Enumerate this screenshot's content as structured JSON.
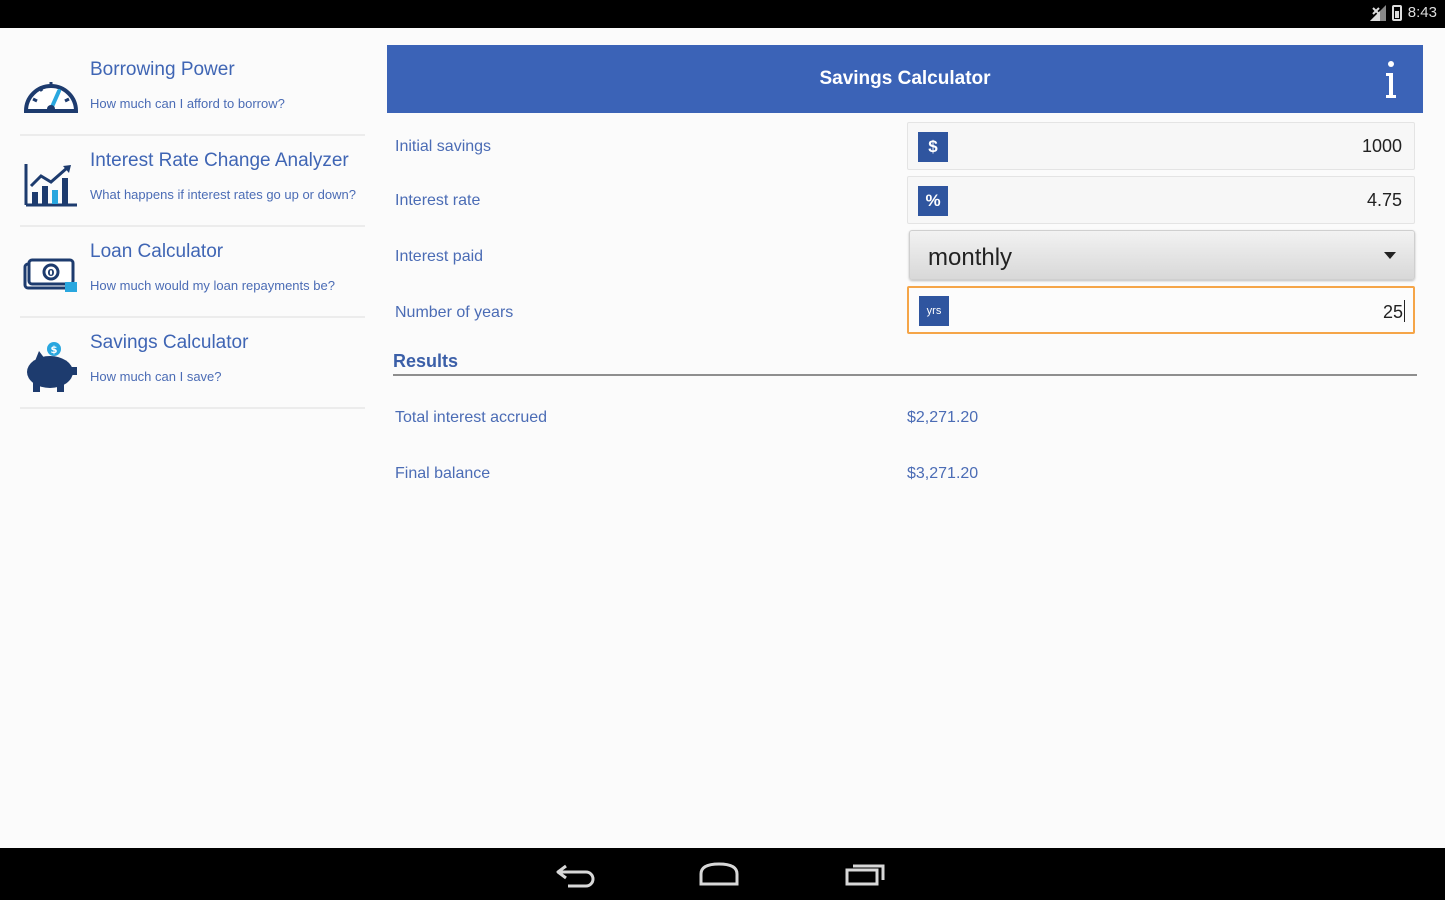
{
  "status_bar": {
    "time": "8:43"
  },
  "sidebar": {
    "items": [
      {
        "title": "Borrowing Power",
        "subtitle": "How much can I afford to borrow?",
        "icon": "speedometer-icon"
      },
      {
        "title": "Interest Rate Change Analyzer",
        "subtitle": "What happens if interest rates go up or down?",
        "icon": "bar-chart-icon"
      },
      {
        "title": "Loan Calculator",
        "subtitle": "How much would my loan repayments be?",
        "icon": "money-icon"
      },
      {
        "title": "Savings Calculator",
        "subtitle": "How much can I save?",
        "icon": "piggy-bank-icon"
      }
    ]
  },
  "header": {
    "title": "Savings Calculator",
    "info_icon": "info-icon"
  },
  "form": {
    "initial_savings": {
      "label": "Initial savings",
      "prefix": "$",
      "value": "1000"
    },
    "interest_rate": {
      "label": "Interest rate",
      "prefix": "%",
      "value": "4.75"
    },
    "interest_paid": {
      "label": "Interest paid",
      "selected": "monthly"
    },
    "number_of_years": {
      "label": "Number of years",
      "prefix": "yrs",
      "value": "25"
    }
  },
  "results": {
    "heading": "Results",
    "total_interest": {
      "label": "Total interest accrued",
      "value": "$2,271.20"
    },
    "final_balance": {
      "label": "Final balance",
      "value": "$3,271.20"
    }
  },
  "colors": {
    "header": "#3b63b7",
    "text_blue": "#4b6cb5",
    "prefix_bg": "#2f559f",
    "focus": "#f5a548"
  }
}
